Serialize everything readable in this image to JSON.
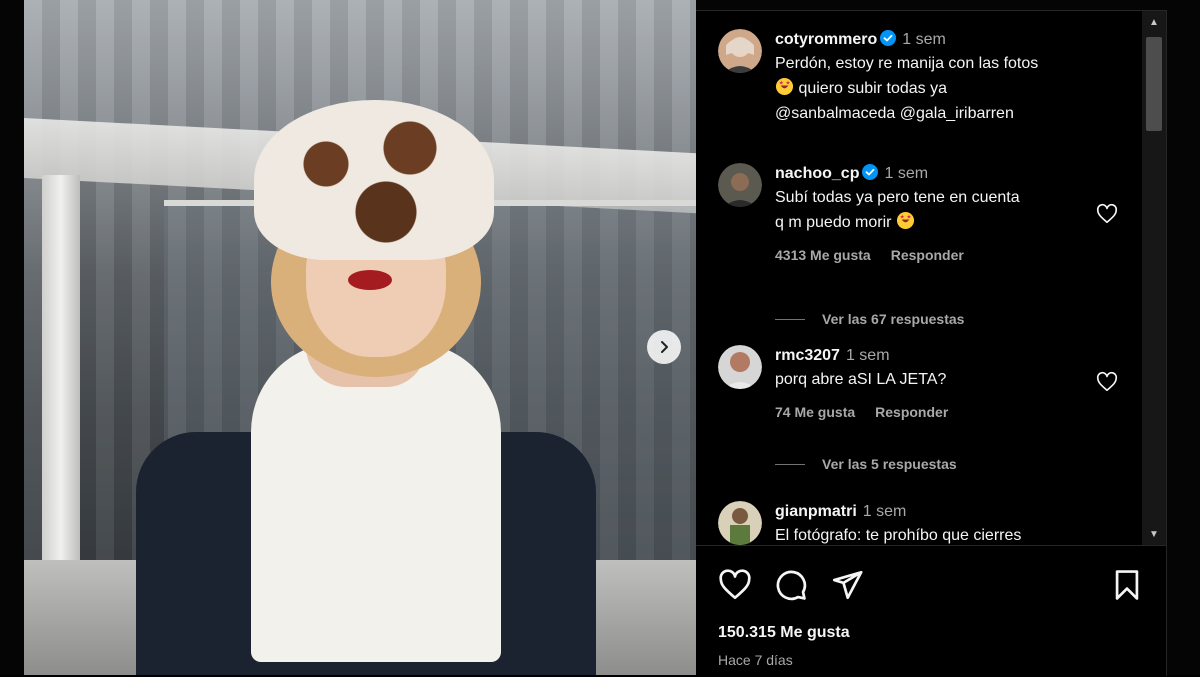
{
  "post": {
    "caption_comment": {
      "username": "cotyrommero",
      "time": "1 sem",
      "line1": "Perdón, estoy re manija con las fotos",
      "line2": "quiero subir todas ya",
      "mentions": "@sanbalmaceda @gala_iribarren"
    },
    "comments": [
      {
        "username": "nachoo_cp",
        "time": "1 sem",
        "line1": "Subí todas ya pero tene en cuenta",
        "line2": "q m puedo morir",
        "likes": "4313 Me gusta",
        "reply": "Responder",
        "view_replies": "Ver las 67 respuestas"
      },
      {
        "username": "rmc3207",
        "time": "1 sem",
        "line1": "porq abre aSI LA JETA?",
        "likes": "74 Me gusta",
        "reply": "Responder",
        "view_replies": "Ver las 5 respuestas"
      },
      {
        "username": "gianpmatri",
        "time": "1 sem",
        "line1": "El fotógrafo: te prohíbo que cierres"
      }
    ],
    "like_count": "150.315 Me gusta",
    "posted_ago": "Hace 7 días"
  },
  "colors": {
    "background": "#000000",
    "text": "#f5f5f5",
    "muted": "#a8a8a8",
    "verified": "#0095f6"
  },
  "icons": [
    "heart-icon",
    "comment-icon",
    "share-icon",
    "bookmark-icon",
    "chevron-right-icon",
    "verified-badge-icon",
    "star-eyes-emoji"
  ]
}
